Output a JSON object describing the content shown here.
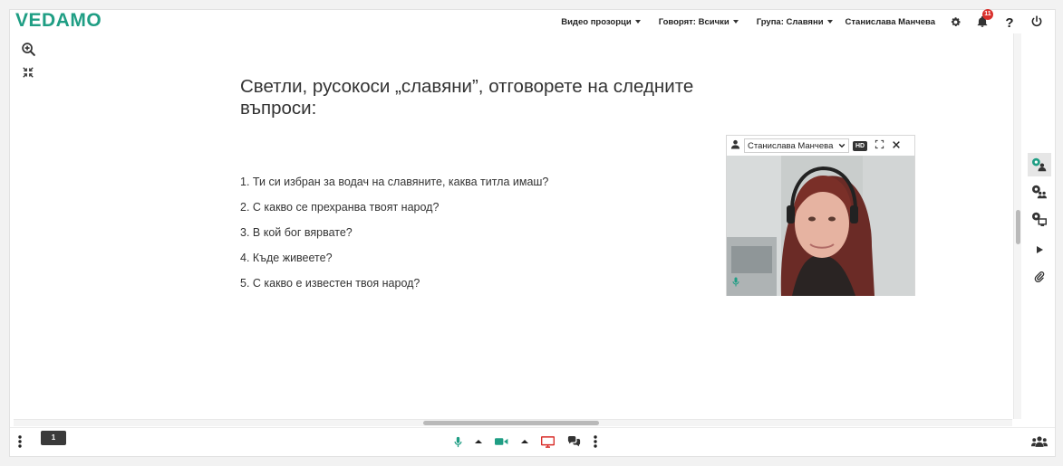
{
  "app": {
    "logo": "VEDAMO"
  },
  "topbar": {
    "video_windows": "Видео прозорци",
    "speakers": "Говорят: Всички",
    "group": "Група: Славяни",
    "user": "Станислава Манчева",
    "notifications_count": "11"
  },
  "slide": {
    "title": "Светли, русокоси „славяни”, отговорете на следните въпроси:",
    "questions": [
      "1. Ти си избран за водач на славяните, каква титла имаш?",
      "2. С какво се прехранва твоят народ?",
      "3. В кой бог вярвате?",
      "4. Къде живеете?",
      "5. С какво е известен твоя народ?"
    ]
  },
  "video_panel": {
    "participant": "Станислава Манчева",
    "quality_badge": "HD"
  },
  "bottombar": {
    "page_number": "1"
  },
  "colors": {
    "brand": "#1f9e84",
    "accent_red": "#d9302c",
    "mic_green": "#1f9e84"
  }
}
